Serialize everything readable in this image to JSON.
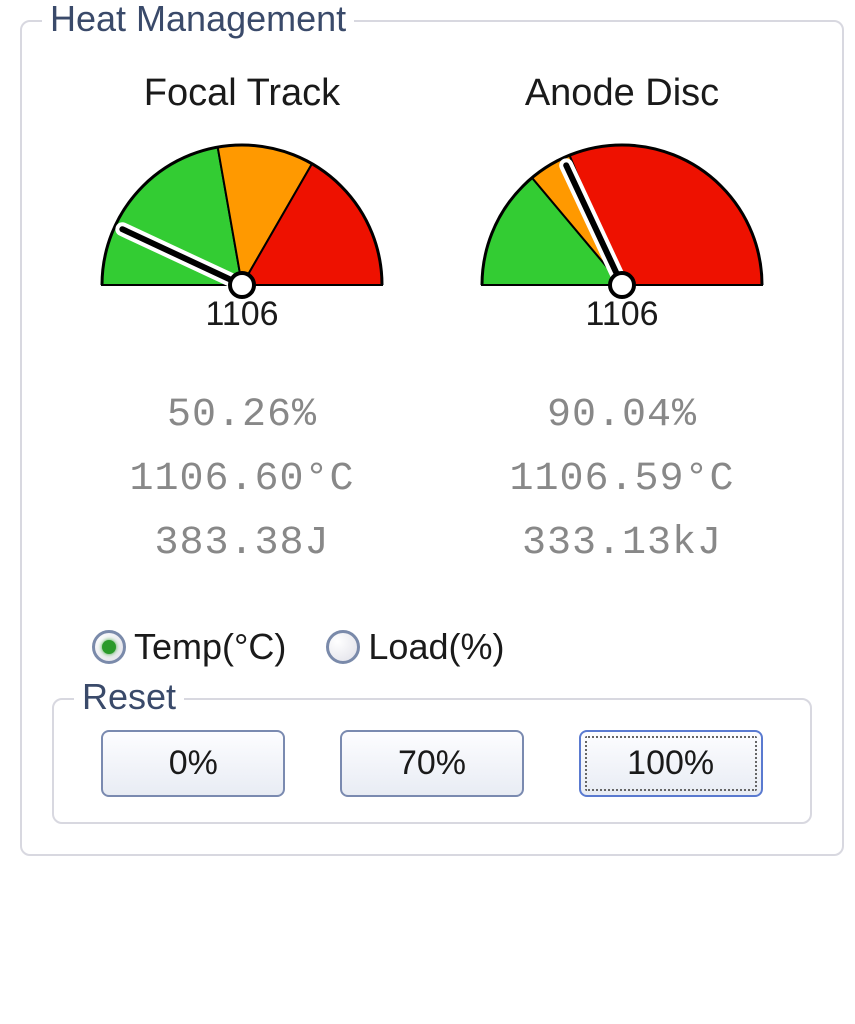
{
  "panel": {
    "title": "Heat Management"
  },
  "gauges": {
    "focal": {
      "title": "Focal Track",
      "value": "1106",
      "needle_angle": -65,
      "zones": [
        {
          "start": -90,
          "end": -10,
          "color": "#33cc33"
        },
        {
          "start": -10,
          "end": 30,
          "color": "#ff9900"
        },
        {
          "start": 30,
          "end": 90,
          "color": "#ee1100"
        }
      ]
    },
    "anode": {
      "title": "Anode Disc",
      "value": "1106",
      "needle_angle": -25,
      "zones": [
        {
          "start": -90,
          "end": -40,
          "color": "#33cc33"
        },
        {
          "start": -40,
          "end": -22,
          "color": "#ff9900"
        },
        {
          "start": -22,
          "end": 90,
          "color": "#ee1100"
        }
      ]
    }
  },
  "stats": {
    "focal": {
      "percent": "50.26%",
      "temp": "1106.60°C",
      "energy": "383.38J"
    },
    "anode": {
      "percent": "90.04%",
      "temp": "1106.59°C",
      "energy": "333.13kJ"
    }
  },
  "radios": {
    "temp_label": "Temp(°C)",
    "load_label": "Load(%)",
    "selected": "temp"
  },
  "reset": {
    "title": "Reset",
    "btn0": "0%",
    "btn70": "70%",
    "btn100": "100%"
  },
  "chart_data": [
    {
      "type": "gauge",
      "title": "Focal Track",
      "value": 1106,
      "percent": 50.26,
      "temp_c": 1106.6,
      "energy_j": 383.38,
      "needle_deg_from_up": -65,
      "zones_deg_from_up": [
        {
          "start": -90,
          "end": -10,
          "color": "#33cc33"
        },
        {
          "start": -10,
          "end": 30,
          "color": "#ff9900"
        },
        {
          "start": 30,
          "end": 90,
          "color": "#ee1100"
        }
      ]
    },
    {
      "type": "gauge",
      "title": "Anode Disc",
      "value": 1106,
      "percent": 90.04,
      "temp_c": 1106.59,
      "energy_kj": 333.13,
      "needle_deg_from_up": -25,
      "zones_deg_from_up": [
        {
          "start": -90,
          "end": -40,
          "color": "#33cc33"
        },
        {
          "start": -40,
          "end": -22,
          "color": "#ff9900"
        },
        {
          "start": -22,
          "end": 90,
          "color": "#ee1100"
        }
      ]
    }
  ]
}
